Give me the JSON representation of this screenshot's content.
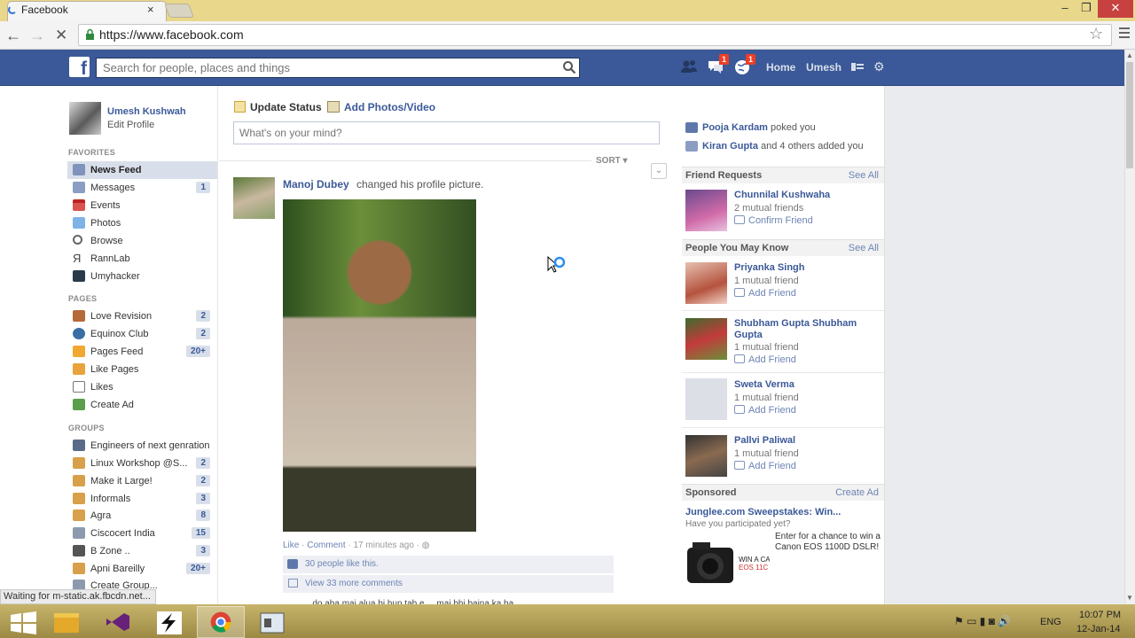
{
  "browser": {
    "tab_title": "Facebook",
    "tab_close": "×",
    "url": "https://www.facebook.com",
    "window_min": "–",
    "window_max": "❐",
    "window_close": "✕",
    "status_text": "Waiting for m-static.ak.fbcdn.net..."
  },
  "fb_header": {
    "logo": "f",
    "search_placeholder": "Search for people, places and things",
    "messages_badge": "1",
    "notifications_badge": "1",
    "home": "Home",
    "user": "Umesh"
  },
  "left_sidebar": {
    "profile_name": "Umesh Kushwah",
    "profile_edit": "Edit Profile",
    "favorites_header": "FAVORITES",
    "favorites": [
      {
        "label": "News Feed",
        "count": "",
        "icon": "news-feed-icon"
      },
      {
        "label": "Messages",
        "count": "1",
        "icon": "messages-icon"
      },
      {
        "label": "Events",
        "count": "",
        "icon": "events-icon"
      },
      {
        "label": "Photos",
        "count": "",
        "icon": "photos-icon"
      },
      {
        "label": "Browse",
        "count": "",
        "icon": "browse-icon"
      },
      {
        "label": "RannLab",
        "count": "",
        "icon": "rannlab-icon"
      },
      {
        "label": "Umyhacker",
        "count": "",
        "icon": "umyhacker-icon"
      }
    ],
    "pages_header": "PAGES",
    "pages": [
      {
        "label": "Love Revision",
        "count": "2",
        "icon": "page-icon"
      },
      {
        "label": "Equinox Club",
        "count": "2",
        "icon": "page-icon"
      },
      {
        "label": "Pages Feed",
        "count": "20+",
        "icon": "pages-feed-icon"
      },
      {
        "label": "Like Pages",
        "count": "",
        "icon": "like-pages-icon"
      },
      {
        "label": "Likes",
        "count": "",
        "icon": "likes-icon"
      },
      {
        "label": "Create Ad",
        "count": "",
        "icon": "create-ad-icon"
      }
    ],
    "groups_header": "GROUPS",
    "groups": [
      {
        "label": "Engineers of next genration",
        "count": "",
        "icon": "group-icon"
      },
      {
        "label": "Linux Workshop @S...",
        "count": "2",
        "icon": "group-icon"
      },
      {
        "label": "Make it Large!",
        "count": "2",
        "icon": "group-icon"
      },
      {
        "label": "Informals",
        "count": "3",
        "icon": "group-icon"
      },
      {
        "label": "Agra",
        "count": "8",
        "icon": "group-icon"
      },
      {
        "label": "Ciscocert India",
        "count": "15",
        "icon": "group-icon"
      },
      {
        "label": "B Zone ..",
        "count": "3",
        "icon": "group-icon"
      },
      {
        "label": "Apni Bareilly",
        "count": "20+",
        "icon": "group-icon"
      },
      {
        "label": "Create Group...",
        "count": "",
        "icon": "create-group-icon"
      }
    ]
  },
  "composer": {
    "update_status": "Update Status",
    "add_photos": "Add Photos/Video",
    "placeholder": "What's on your mind?"
  },
  "feed": {
    "sort": "SORT ▾",
    "story": {
      "author": "Manoj Dubey",
      "action": "changed his profile picture.",
      "like": "Like",
      "comment": "Comment",
      "time": "17 minutes ago",
      "likes": "30 people like this.",
      "view_comments": "View 33 more comments",
      "comment_snippet": "...do aba mai alua bi hun tab e ... mai bhi baina ka ba..."
    }
  },
  "right_sidebar": {
    "poke_name": "Pooja Kardam",
    "poke_text": "poked you",
    "added_name": "Kiran Gupta",
    "added_text": "and 4 others added you",
    "friend_requests_header": "Friend Requests",
    "see_all": "See All",
    "friend_requests": [
      {
        "name": "Chunnilal Kushwaha",
        "mutual": "2 mutual friends",
        "action": "Confirm Friend"
      }
    ],
    "pymk_header": "People You May Know",
    "pymk": [
      {
        "name": "Priyanka Singh",
        "mutual": "1 mutual friend",
        "action": "Add Friend"
      },
      {
        "name": "Shubham Gupta Shubham Gupta",
        "mutual": "1 mutual friend",
        "action": "Add Friend"
      },
      {
        "name": "Sweta Verma",
        "mutual": "1 mutual friend",
        "action": "Add Friend"
      },
      {
        "name": "Pallvi Paliwal",
        "mutual": "1 mutual friend",
        "action": "Add Friend"
      }
    ],
    "sponsored_header": "Sponsored",
    "create_ad": "Create Ad",
    "ad_title": "Junglee.com Sweepstakes: Win...",
    "ad_subtitle": "Have you participated yet?",
    "ad_body": "Enter for a chance to win a Canon EOS 1100D DSLR!"
  },
  "taskbar": {
    "lang": "ENG",
    "time": "10:07 PM",
    "date": "12-Jan-14"
  }
}
